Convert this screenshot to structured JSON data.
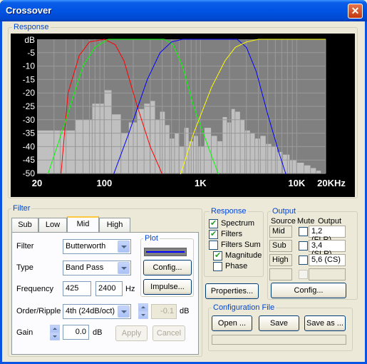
{
  "window": {
    "title": "Crossover"
  },
  "response_plot": {
    "legend": "Response",
    "y_unit": "dB",
    "y_ticks": [
      "-5",
      "-10",
      "-15",
      "-20",
      "-25",
      "-30",
      "-35",
      "-40",
      "-45",
      "-50"
    ],
    "x_ticks": [
      "20",
      "100",
      "1K",
      "10K",
      "20KHz"
    ],
    "colors": {
      "bg": "#808080",
      "grid": "#9a9a9a",
      "low": "#ff0000",
      "mid": "#00ff00",
      "high": "#0000ff",
      "sub": "#ffff00",
      "spectrum": "#c0c0c0"
    }
  },
  "chart_data": {
    "type": "line",
    "xscale": "log",
    "xlim": [
      20,
      20000
    ],
    "ylim": [
      -50,
      0
    ],
    "ylabel": "dB",
    "series": [
      {
        "name": "",
        "color": "#ff0000",
        "points": [
          [
            30,
            -80
          ],
          [
            42,
            -20
          ],
          [
            55,
            -6
          ],
          [
            70,
            -1
          ],
          [
            100,
            0
          ],
          [
            130,
            -2
          ],
          [
            160,
            -8
          ],
          [
            220,
            -25
          ],
          [
            300,
            -40
          ],
          [
            420,
            -52
          ]
        ]
      },
      {
        "name": "",
        "color": "#00ff00",
        "points": [
          [
            25,
            -52
          ],
          [
            40,
            -30
          ],
          [
            60,
            -10
          ],
          [
            80,
            -3
          ],
          [
            110,
            0
          ],
          [
            420,
            0
          ],
          [
            520,
            -2
          ],
          [
            650,
            -10
          ],
          [
            850,
            -25
          ],
          [
            1200,
            -40
          ],
          [
            1600,
            -52
          ]
        ]
      },
      {
        "name": "",
        "color": "#0000ff",
        "points": [
          [
            120,
            -52
          ],
          [
            180,
            -35
          ],
          [
            280,
            -15
          ],
          [
            380,
            -5
          ],
          [
            500,
            -1
          ],
          [
            650,
            0
          ],
          [
            2400,
            0
          ],
          [
            3000,
            -3
          ],
          [
            3800,
            -12
          ],
          [
            5000,
            -28
          ],
          [
            6500,
            -42
          ],
          [
            8000,
            -52
          ]
        ]
      },
      {
        "name": "",
        "color": "#ffff00",
        "points": [
          [
            600,
            -52
          ],
          [
            850,
            -35
          ],
          [
            1300,
            -18
          ],
          [
            1800,
            -8
          ],
          [
            2300,
            -3
          ],
          [
            3000,
            -1
          ],
          [
            4000,
            0
          ],
          [
            20000,
            0
          ]
        ]
      }
    ]
  },
  "filter": {
    "legend": "Filter",
    "tabs": [
      "Sub",
      "Low",
      "Mid",
      "High"
    ],
    "active_tab": "Mid",
    "filter_label": "Filter",
    "filter_value": "Butterworth",
    "type_label": "Type",
    "type_value": "Band Pass",
    "frequency_label": "Frequency",
    "freq_low": "425",
    "freq_high": "2400",
    "freq_unit": "Hz",
    "order_label": "Order/Ripple",
    "order_value": "4th (24dB/oct)",
    "ripple_value": "-0.1",
    "ripple_unit": "dB",
    "gain_label": "Gain",
    "gain_value": "0.0",
    "gain_unit": "dB",
    "apply_label": "Apply",
    "cancel_label": "Cancel",
    "plot_legend": "Plot",
    "plot_color": "#0000ff",
    "config_label": "Config...",
    "impulse_label": "Impulse..."
  },
  "response_opts": {
    "legend": "Response",
    "spectrum": "Spectrum",
    "filters": "Filters",
    "filters_sum": "Filters Sum",
    "magnitude": "Magnitude",
    "phase": "Phase",
    "properties_label": "Properties..."
  },
  "output": {
    "legend": "Output",
    "headers": [
      "Source",
      "Mute",
      "Output"
    ],
    "rows": [
      {
        "source": "Mid",
        "output": "1,2 (FLR)"
      },
      {
        "source": "Sub",
        "output": "3,4 (SLR)"
      },
      {
        "source": "High",
        "output": "5,6 (CS)"
      }
    ],
    "config_label": "Config..."
  },
  "config_file": {
    "legend": "Configuration File",
    "open_label": "Open ...",
    "save_label": "Save",
    "save_as_label": "Save as ..."
  }
}
